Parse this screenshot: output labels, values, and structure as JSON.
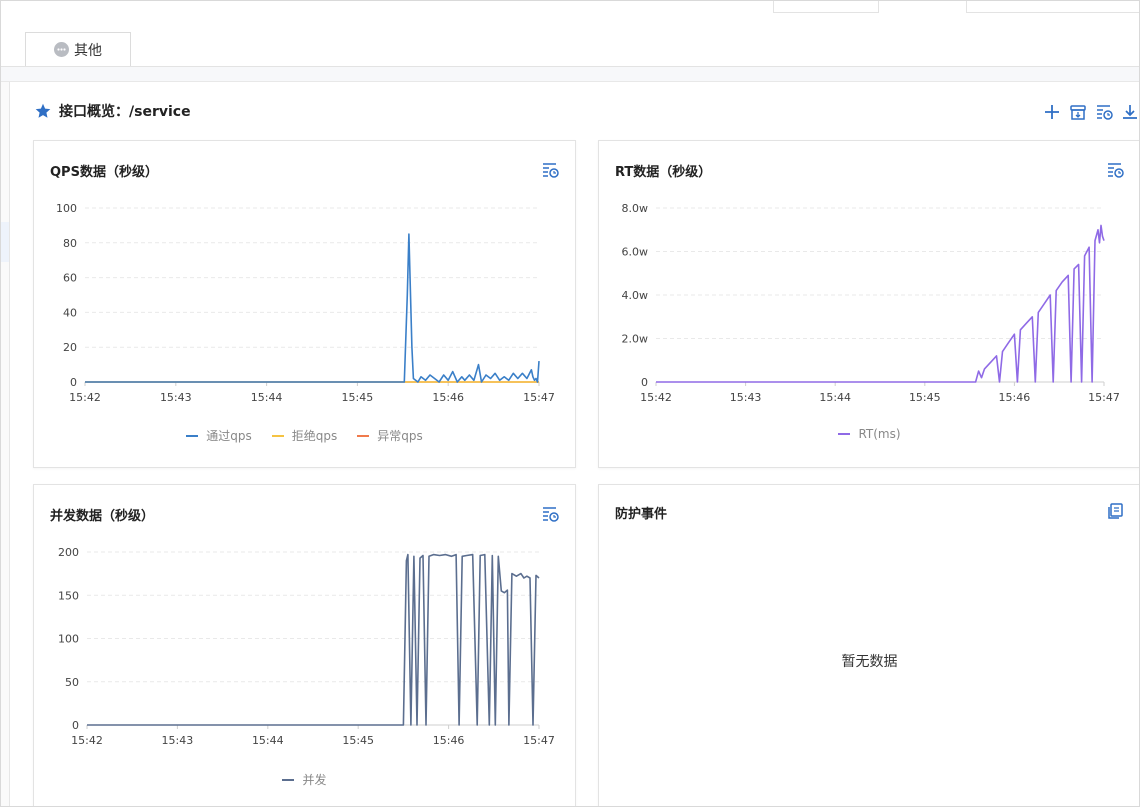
{
  "tabbar": {
    "other_label": "其他"
  },
  "page": {
    "title": "接口概览：/service"
  },
  "colors": {
    "accent": "#2f6fc5",
    "pass": "#3a7fc8",
    "reject": "#f5c342",
    "error": "#f07a4c",
    "rt": "#8f6ae6",
    "concurrency": "#5b6e8f",
    "grid": "#e9e9e9"
  },
  "icons": [
    "plus-icon",
    "archive-download-icon",
    "list-clock-icon",
    "download-icon"
  ],
  "cards": {
    "qps": {
      "title": "QPS数据（秒级）",
      "legend": [
        "通过qps",
        "拒绝qps",
        "异常qps"
      ]
    },
    "rt": {
      "title": "RT数据（秒级）",
      "legend": [
        "RT(ms)"
      ]
    },
    "concurrency": {
      "title": "并发数据（秒级）",
      "legend": [
        "并发"
      ]
    },
    "events": {
      "title": "防护事件",
      "empty": "暂无数据"
    }
  },
  "chart_data": [
    {
      "type": "line",
      "title": "QPS数据（秒级）",
      "x_ticks": [
        "15:42",
        "15:43",
        "15:44",
        "15:45",
        "15:46",
        "15:47"
      ],
      "y_ticks": [
        "0",
        "20",
        "40",
        "60",
        "80",
        "100"
      ],
      "ylim": [
        0,
        100
      ],
      "xlim": [
        0,
        300
      ],
      "series": [
        {
          "name": "通过qps",
          "color": "#3a7fc8",
          "points": [
            [
              0,
              0
            ],
            [
              211,
              0
            ],
            [
              213,
              50
            ],
            [
              214,
              85
            ],
            [
              216,
              20
            ],
            [
              217,
              2
            ],
            [
              220,
              0
            ],
            [
              222,
              3
            ],
            [
              225,
              1
            ],
            [
              228,
              4
            ],
            [
              231,
              2
            ],
            [
              234,
              0
            ],
            [
              237,
              4
            ],
            [
              240,
              1
            ],
            [
              243,
              6
            ],
            [
              246,
              0
            ],
            [
              249,
              3
            ],
            [
              251,
              1
            ],
            [
              254,
              4
            ],
            [
              257,
              1
            ],
            [
              260,
              10
            ],
            [
              262,
              0
            ],
            [
              265,
              4
            ],
            [
              268,
              2
            ],
            [
              271,
              5
            ],
            [
              274,
              1
            ],
            [
              277,
              3
            ],
            [
              280,
              1
            ],
            [
              283,
              5
            ],
            [
              286,
              2
            ],
            [
              289,
              5
            ],
            [
              292,
              2
            ],
            [
              295,
              7
            ],
            [
              296,
              3
            ],
            [
              297,
              1
            ],
            [
              298,
              2
            ],
            [
              299,
              0
            ],
            [
              300,
              12
            ]
          ]
        },
        {
          "name": "拒绝qps",
          "color": "#f5c342",
          "points": [
            [
              0,
              0
            ],
            [
              300,
              0
            ]
          ]
        },
        {
          "name": "异常qps",
          "color": "#f07a4c",
          "points": [
            [
              0,
              0
            ],
            [
              300,
              0
            ]
          ]
        }
      ]
    },
    {
      "type": "line",
      "title": "RT数据（秒级）",
      "x_ticks": [
        "15:42",
        "15:43",
        "15:44",
        "15:45",
        "15:46",
        "15:47"
      ],
      "y_ticks": [
        "0",
        "2.0w",
        "4.0w",
        "6.0w",
        "8.0w"
      ],
      "ylim": [
        0,
        80000
      ],
      "xlim": [
        0,
        300
      ],
      "series": [
        {
          "name": "RT(ms)",
          "color": "#8f6ae6",
          "points": [
            [
              0,
              0
            ],
            [
              214,
              0
            ],
            [
              216,
              5000
            ],
            [
              218,
              2000
            ],
            [
              220,
              6000
            ],
            [
              224,
              9000
            ],
            [
              228,
              12000
            ],
            [
              230,
              0
            ],
            [
              232,
              14000
            ],
            [
              236,
              18000
            ],
            [
              240,
              22000
            ],
            [
              242,
              0
            ],
            [
              244,
              24000
            ],
            [
              248,
              27000
            ],
            [
              252,
              30000
            ],
            [
              254,
              0
            ],
            [
              256,
              32000
            ],
            [
              260,
              36000
            ],
            [
              264,
              40000
            ],
            [
              266,
              0
            ],
            [
              268,
              42000
            ],
            [
              272,
              46000
            ],
            [
              276,
              49000
            ],
            [
              278,
              0
            ],
            [
              280,
              52000
            ],
            [
              283,
              54000
            ],
            [
              285,
              0
            ],
            [
              287,
              58000
            ],
            [
              290,
              62000
            ],
            [
              292,
              0
            ],
            [
              294,
              65000
            ],
            [
              296,
              70000
            ],
            [
              297,
              64000
            ],
            [
              298,
              72000
            ],
            [
              299,
              67000
            ],
            [
              300,
              65000
            ]
          ]
        }
      ]
    },
    {
      "type": "line",
      "title": "并发数据（秒级）",
      "x_ticks": [
        "15:42",
        "15:43",
        "15:44",
        "15:45",
        "15:46",
        "15:47"
      ],
      "y_ticks": [
        "0",
        "50",
        "100",
        "150",
        "200"
      ],
      "ylim": [
        0,
        200
      ],
      "xlim": [
        0,
        300
      ],
      "series": [
        {
          "name": "并发",
          "color": "#5b6e8f",
          "points": [
            [
              0,
              0
            ],
            [
              210,
              0
            ],
            [
              212,
              190
            ],
            [
              213,
              197
            ],
            [
              215,
              0
            ],
            [
              217,
              195
            ],
            [
              219,
              0
            ],
            [
              221,
              193
            ],
            [
              223,
              196
            ],
            [
              225,
              0
            ],
            [
              227,
              195
            ],
            [
              230,
              197
            ],
            [
              234,
              196
            ],
            [
              238,
              197
            ],
            [
              242,
              195
            ],
            [
              245,
              197
            ],
            [
              247,
              0
            ],
            [
              249,
              195
            ],
            [
              252,
              196
            ],
            [
              256,
              197
            ],
            [
              259,
              0
            ],
            [
              261,
              196
            ],
            [
              264,
              197
            ],
            [
              267,
              0
            ],
            [
              269,
              196
            ],
            [
              271,
              0
            ],
            [
              273,
              195
            ],
            [
              275,
              155
            ],
            [
              277,
              153
            ],
            [
              279,
              156
            ],
            [
              280,
              0
            ],
            [
              282,
              175
            ],
            [
              285,
              172
            ],
            [
              288,
              175
            ],
            [
              290,
              170
            ],
            [
              292,
              172
            ],
            [
              294,
              170
            ],
            [
              296,
              0
            ],
            [
              298,
              173
            ],
            [
              300,
              170
            ]
          ]
        }
      ]
    }
  ]
}
